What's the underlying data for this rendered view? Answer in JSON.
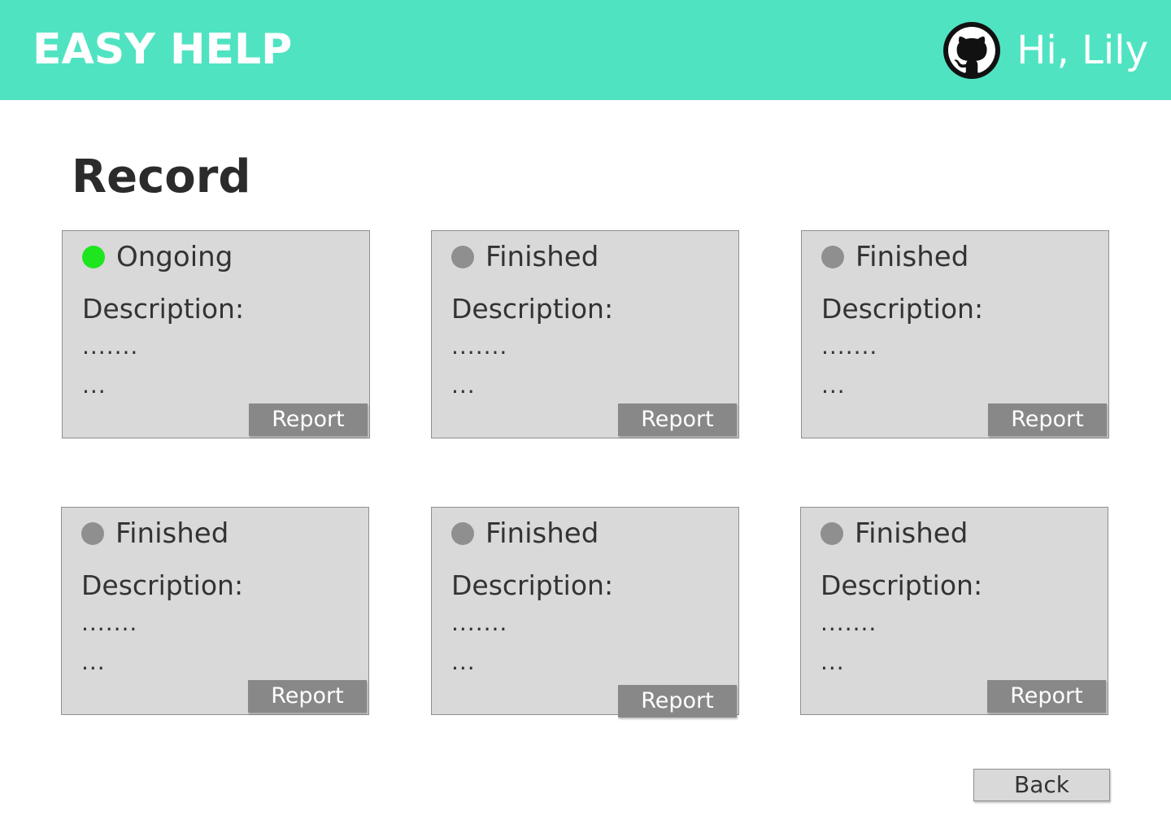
{
  "header": {
    "brand": "EASY HELP",
    "greeting": "Hi, Lily",
    "avatar_icon": "github-octocat-icon",
    "background_color": "#50e3c2"
  },
  "page": {
    "title": "Record"
  },
  "colors": {
    "ongoing_dot": "#1ee51e",
    "finished_dot": "#8f8f8f",
    "card_background": "#d9d9d9",
    "report_button": "#888888"
  },
  "records": [
    {
      "status": "Ongoing",
      "status_color": "#1ee51e",
      "description_label": "Description:",
      "line1": ".......",
      "line2": "...",
      "report_label": "Report"
    },
    {
      "status": "Finished",
      "status_color": "#8f8f8f",
      "description_label": "Description:",
      "line1": ".......",
      "line2": "...",
      "report_label": "Report"
    },
    {
      "status": "Finished",
      "status_color": "#8f8f8f",
      "description_label": "Description:",
      "line1": ".......",
      "line2": "...",
      "report_label": "Report"
    },
    {
      "status": "Finished",
      "status_color": "#8f8f8f",
      "description_label": "Description:",
      "line1": ".......",
      "line2": "...",
      "report_label": "Report"
    },
    {
      "status": "Finished",
      "status_color": "#8f8f8f",
      "description_label": "Description:",
      "line1": ".......",
      "line2": "...",
      "report_label": "Report"
    },
    {
      "status": "Finished",
      "status_color": "#8f8f8f",
      "description_label": "Description:",
      "line1": ".......",
      "line2": "...",
      "report_label": "Report"
    }
  ],
  "footer": {
    "back_label": "Back"
  }
}
